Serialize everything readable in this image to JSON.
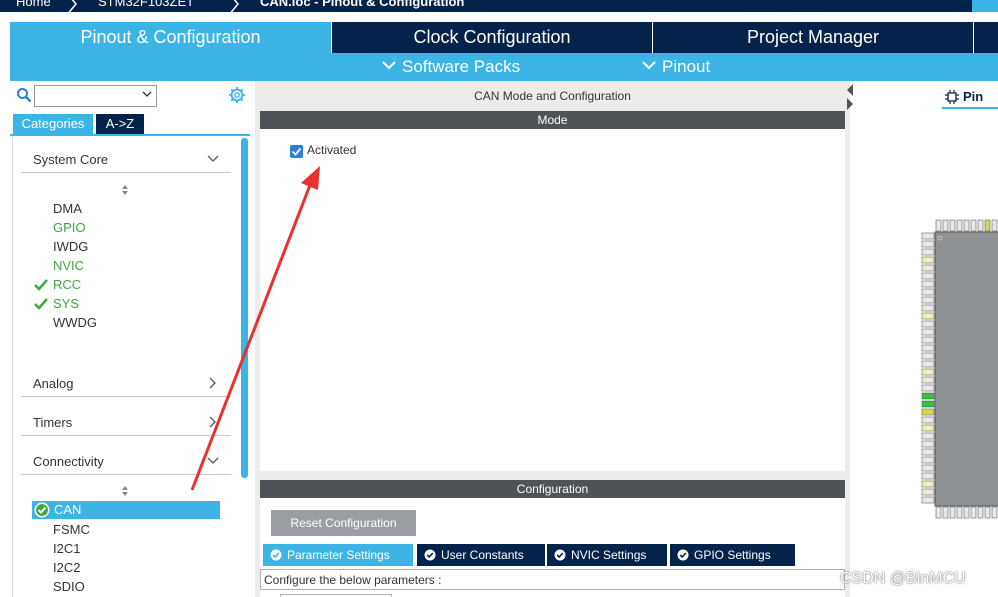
{
  "breadcrumb": {
    "items": [
      "Home",
      "STM32F103ZET",
      "CAN.ioc - Pinout & Configuration"
    ]
  },
  "main_tabs": [
    {
      "label": "Pinout & Configuration",
      "active": true
    },
    {
      "label": "Clock Configuration",
      "active": false
    },
    {
      "label": "Project Manager",
      "active": false
    }
  ],
  "sub_menu": {
    "software_packs": "Software Packs",
    "pinout": "Pinout"
  },
  "left": {
    "search_value": "",
    "tabs": {
      "categories": "Categories",
      "az": "A->Z"
    },
    "sections": [
      {
        "label": "System Core",
        "expanded": true
      },
      {
        "label": "Analog",
        "expanded": false
      },
      {
        "label": "Timers",
        "expanded": false
      },
      {
        "label": "Connectivity",
        "expanded": true
      }
    ],
    "system_core_items": [
      {
        "label": "DMA",
        "state": "normal"
      },
      {
        "label": "GPIO",
        "state": "green"
      },
      {
        "label": "IWDG",
        "state": "normal"
      },
      {
        "label": "NVIC",
        "state": "green"
      },
      {
        "label": "RCC",
        "state": "checked"
      },
      {
        "label": "SYS",
        "state": "checked"
      },
      {
        "label": "WWDG",
        "state": "normal"
      }
    ],
    "connectivity_items": [
      {
        "label": "CAN",
        "state": "selected"
      },
      {
        "label": "FSMC",
        "state": "normal"
      },
      {
        "label": "I2C1",
        "state": "normal"
      },
      {
        "label": "I2C2",
        "state": "normal"
      },
      {
        "label": "SDIO",
        "state": "normal"
      }
    ]
  },
  "center": {
    "title": "CAN Mode and Configuration",
    "mode_header": "Mode",
    "activated_label": "Activated",
    "activated_checked": true,
    "config_header": "Configuration",
    "reset_button": "Reset Configuration",
    "tabs": [
      {
        "label": "Parameter Settings",
        "active": true
      },
      {
        "label": "User Constants",
        "active": false
      },
      {
        "label": "NVIC Settings",
        "active": false
      },
      {
        "label": "GPIO Settings",
        "active": false
      }
    ],
    "param_text": "Configure the below parameters :"
  },
  "right": {
    "pinout_tab": "Pin"
  },
  "watermark": "CSDN @BinMCU",
  "colors": {
    "accent": "#3cb4e6",
    "dark": "#03234b",
    "green": "#3fa83f",
    "annotation": "#e8322d"
  }
}
